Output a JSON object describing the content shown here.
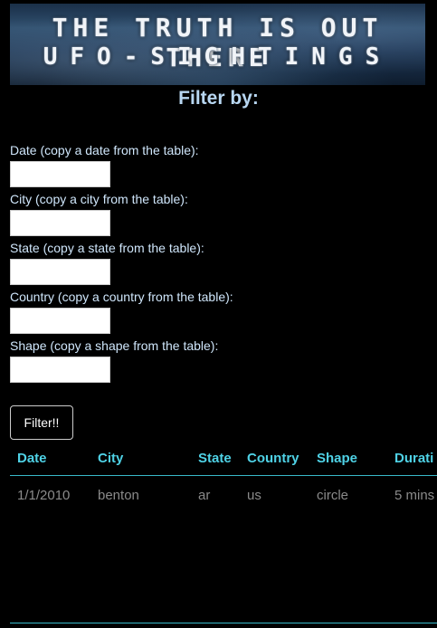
{
  "banner": {
    "line1": "THE TRUTH IS OUT THERE",
    "line2": "UFO-SIGHTINGS"
  },
  "heading": "Filter by:",
  "fields": [
    {
      "label": "Date (copy a date from the table):",
      "value": ""
    },
    {
      "label": "City (copy a city from the table):",
      "value": ""
    },
    {
      "label": "State (copy a state from the table):",
      "value": ""
    },
    {
      "label": "Country (copy a country from the table):",
      "value": ""
    },
    {
      "label": "Shape (copy a shape from the table):",
      "value": ""
    }
  ],
  "filter_button": "Filter!!",
  "table": {
    "columns": [
      "Date",
      "City",
      "State",
      "Country",
      "Shape",
      "Durati"
    ],
    "rows": [
      [
        "1/1/2010",
        "benton",
        "ar",
        "us",
        "circle",
        "5 mins"
      ]
    ]
  },
  "colors": {
    "background": "#000000",
    "heading": "#b8d7f2",
    "label": "#cfe6fb",
    "table_header": "#4fd2e6",
    "table_cell": "#8a8a8a",
    "rule": "#38b9c9"
  }
}
